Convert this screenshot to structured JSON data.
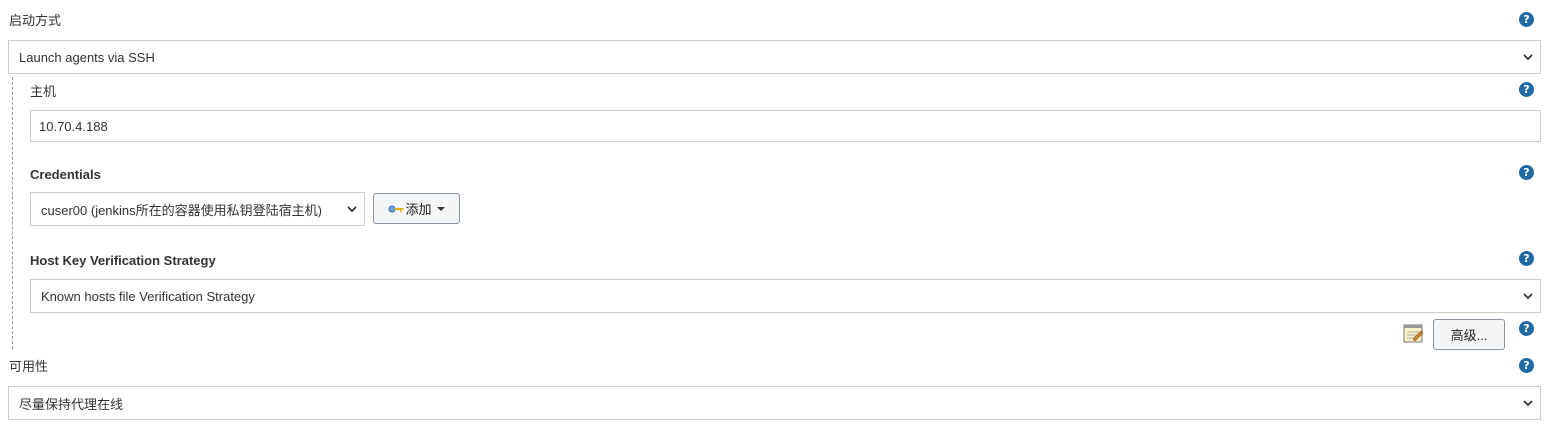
{
  "launch": {
    "label": "启动方式",
    "value": "Launch agents via SSH"
  },
  "host": {
    "label": "主机",
    "value": "10.70.4.188"
  },
  "credentials": {
    "label": "Credentials",
    "value": "cuser00 (jenkins所在的容器使用私钥登陆宿主机)",
    "add_label": "添加",
    "add_icon": "key-icon"
  },
  "host_key": {
    "label": "Host Key Verification Strategy",
    "value": "Known hosts file Verification Strategy"
  },
  "advanced": {
    "label": "高级...",
    "icon": "notepad-icon"
  },
  "availability": {
    "label": "可用性",
    "value": "尽量保持代理在线"
  },
  "help_glyph": "?",
  "colors": {
    "help": "#1f6aa5",
    "border": "#cccccc",
    "text": "#333333"
  }
}
